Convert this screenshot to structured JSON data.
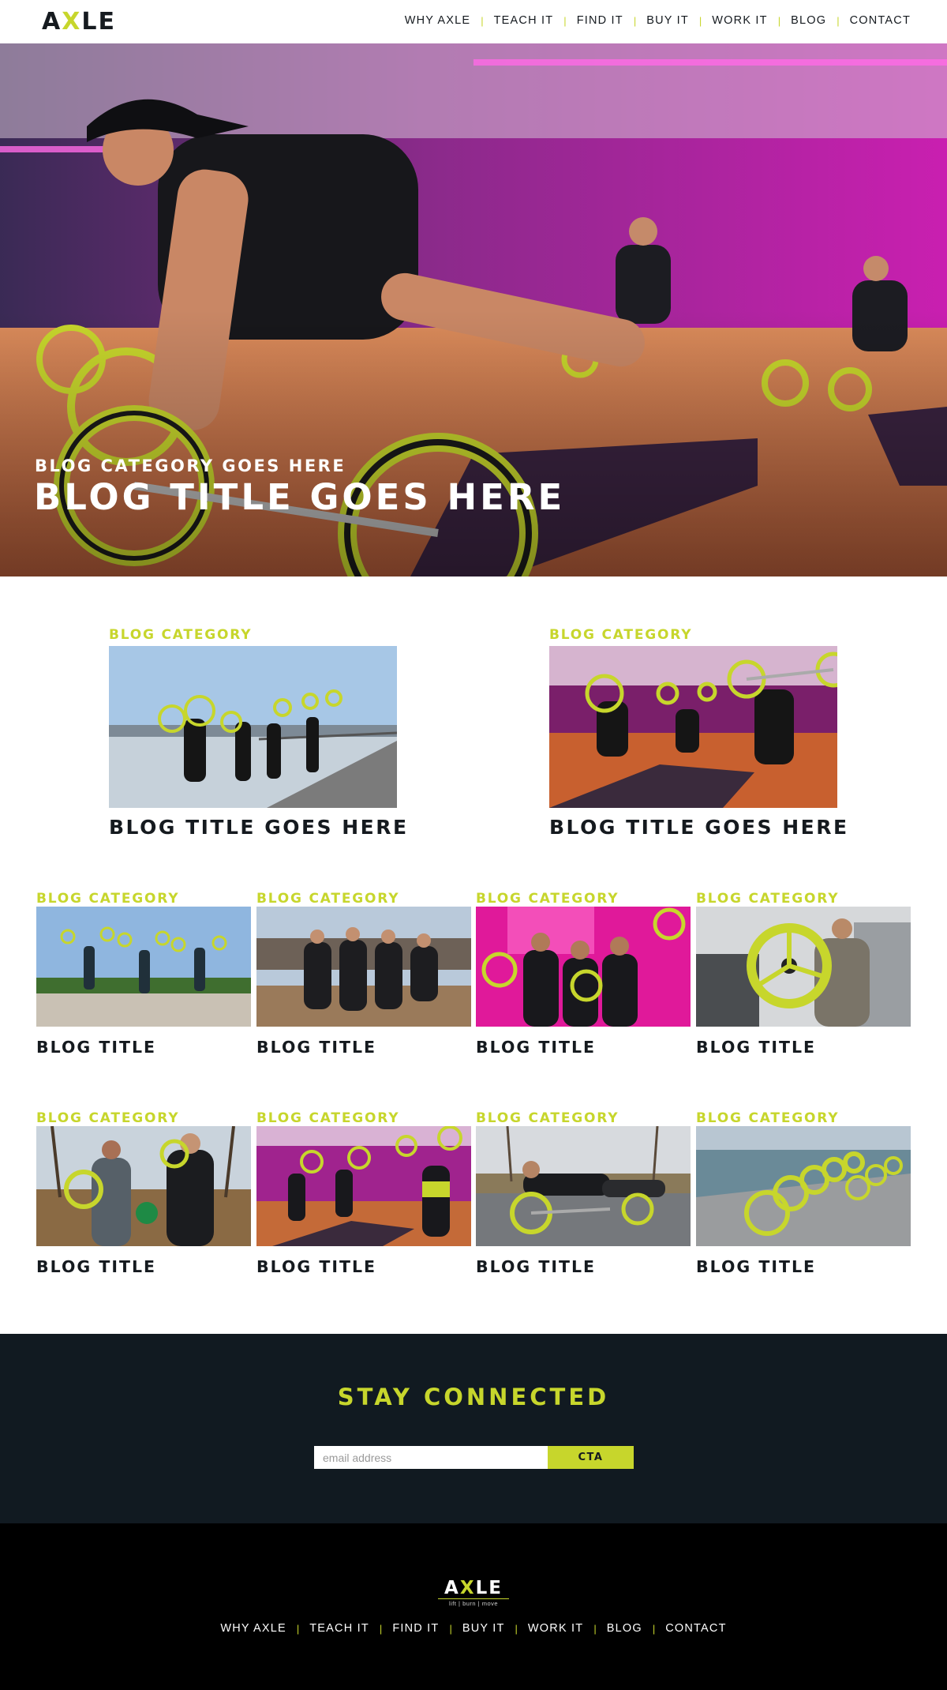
{
  "brand": {
    "logo_prefix": "A",
    "logo_x": "X",
    "logo_suffix": "LE",
    "tagline": "lift | burn | move",
    "accent_color": "#c7d62c",
    "dark_color": "#111a21"
  },
  "nav": {
    "items": [
      "WHY AXLE",
      "TEACH IT",
      "FIND IT",
      "BUY IT",
      "WORK IT",
      "BLOG",
      "CONTACT"
    ],
    "separator": "|"
  },
  "hero": {
    "category": "BLOG CATEGORY GOES HERE",
    "title": "BLOG TITLE GOES HERE",
    "image": "group-workout-gym-photo"
  },
  "featured_posts": [
    {
      "category": "BLOG CATEGORY",
      "title": "BLOG TITLE GOES HERE",
      "image": "waterfront-group-lift-photo"
    },
    {
      "category": "BLOG CATEGORY",
      "title": "BLOG TITLE GOES HERE",
      "image": "studio-lunge-class-photo"
    }
  ],
  "posts": [
    {
      "category": "BLOG CATEGORY",
      "title": "BLOG TITLE",
      "image": "park-overhead-lift-photo"
    },
    {
      "category": "BLOG CATEGORY",
      "title": "BLOG TITLE",
      "image": "group-on-fence-photo"
    },
    {
      "category": "BLOG CATEGORY",
      "title": "BLOG TITLE",
      "image": "pink-wall-team-photo"
    },
    {
      "category": "BLOG CATEGORY",
      "title": "BLOG TITLE",
      "image": "gym-wheel-hold-photo"
    },
    {
      "category": "BLOG CATEGORY",
      "title": "BLOG TITLE",
      "image": "park-partner-photo"
    },
    {
      "category": "BLOG CATEGORY",
      "title": "BLOG TITLE",
      "image": "pink-studio-class-photo"
    },
    {
      "category": "BLOG CATEGORY",
      "title": "BLOG TITLE",
      "image": "park-pushup-photo"
    },
    {
      "category": "BLOG CATEGORY",
      "title": "BLOG TITLE",
      "image": "axles-on-pavement-photo"
    }
  ],
  "newsletter": {
    "title": "STAY CONNECTED",
    "email_placeholder": "email address",
    "cta_label": "CTA"
  },
  "footer": {
    "nav_items": [
      "WHY AXLE",
      "TEACH IT",
      "FIND IT",
      "BUY IT",
      "WORK IT",
      "BLOG",
      "CONTACT"
    ]
  }
}
